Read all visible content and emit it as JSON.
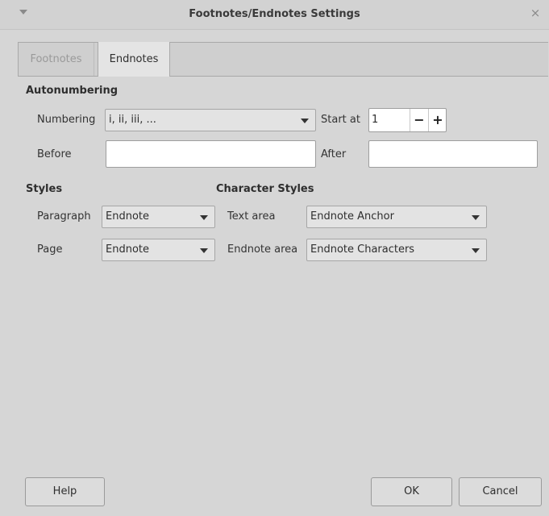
{
  "window": {
    "title": "Footnotes/Endnotes Settings",
    "close_glyph": "×"
  },
  "tabs": [
    {
      "label": "Footnotes"
    },
    {
      "label": "Endnotes"
    }
  ],
  "autonumbering": {
    "heading": "Autonumbering",
    "numbering_label": "Numbering",
    "numbering_value": "i, ii, iii, ...",
    "start_at_label": "Start at",
    "start_at_value": "1",
    "minus_glyph": "−",
    "plus_glyph": "+",
    "before_label": "Before",
    "before_value": "",
    "after_label": "After",
    "after_value": ""
  },
  "styles": {
    "heading": "Styles",
    "paragraph_label": "Paragraph",
    "paragraph_value": "Endnote",
    "page_label": "Page",
    "page_value": "Endnote"
  },
  "character_styles": {
    "heading": "Character Styles",
    "text_area_label": "Text area",
    "text_area_value": "Endnote Anchor",
    "endnote_area_label": "Endnote area",
    "endnote_area_value": "Endnote Characters"
  },
  "buttons": {
    "help": "Help",
    "ok": "OK",
    "cancel": "Cancel"
  }
}
